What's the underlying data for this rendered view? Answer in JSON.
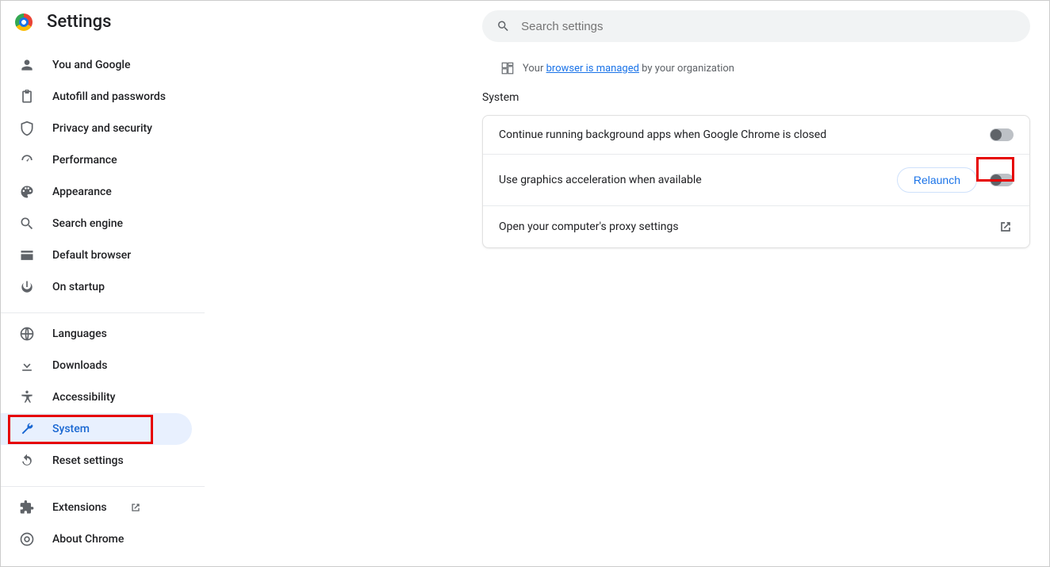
{
  "header": {
    "title": "Settings"
  },
  "search": {
    "placeholder": "Search settings"
  },
  "managed": {
    "prefix": "Your ",
    "link": "browser is managed",
    "suffix": " by your organization"
  },
  "sidebar": {
    "groups": [
      [
        {
          "label": "You and Google",
          "icon": "person"
        },
        {
          "label": "Autofill and passwords",
          "icon": "clipboard"
        },
        {
          "label": "Privacy and security",
          "icon": "shield"
        },
        {
          "label": "Performance",
          "icon": "speed"
        },
        {
          "label": "Appearance",
          "icon": "palette"
        },
        {
          "label": "Search engine",
          "icon": "search"
        },
        {
          "label": "Default browser",
          "icon": "browser"
        },
        {
          "label": "On startup",
          "icon": "power"
        }
      ],
      [
        {
          "label": "Languages",
          "icon": "globe"
        },
        {
          "label": "Downloads",
          "icon": "download"
        },
        {
          "label": "Accessibility",
          "icon": "accessibility"
        },
        {
          "label": "System",
          "icon": "wrench",
          "active": true
        },
        {
          "label": "Reset settings",
          "icon": "restore"
        }
      ],
      [
        {
          "label": "Extensions",
          "icon": "extension",
          "external": true
        },
        {
          "label": "About Chrome",
          "icon": "chrome"
        }
      ]
    ]
  },
  "section": {
    "title": "System",
    "rows": {
      "bg_apps": {
        "label": "Continue running background apps when Google Chrome is closed",
        "toggle": "off"
      },
      "gfx": {
        "label": "Use graphics acceleration when available",
        "relaunch_label": "Relaunch",
        "toggle": "off"
      },
      "proxy": {
        "label": "Open your computer's proxy settings"
      }
    }
  }
}
